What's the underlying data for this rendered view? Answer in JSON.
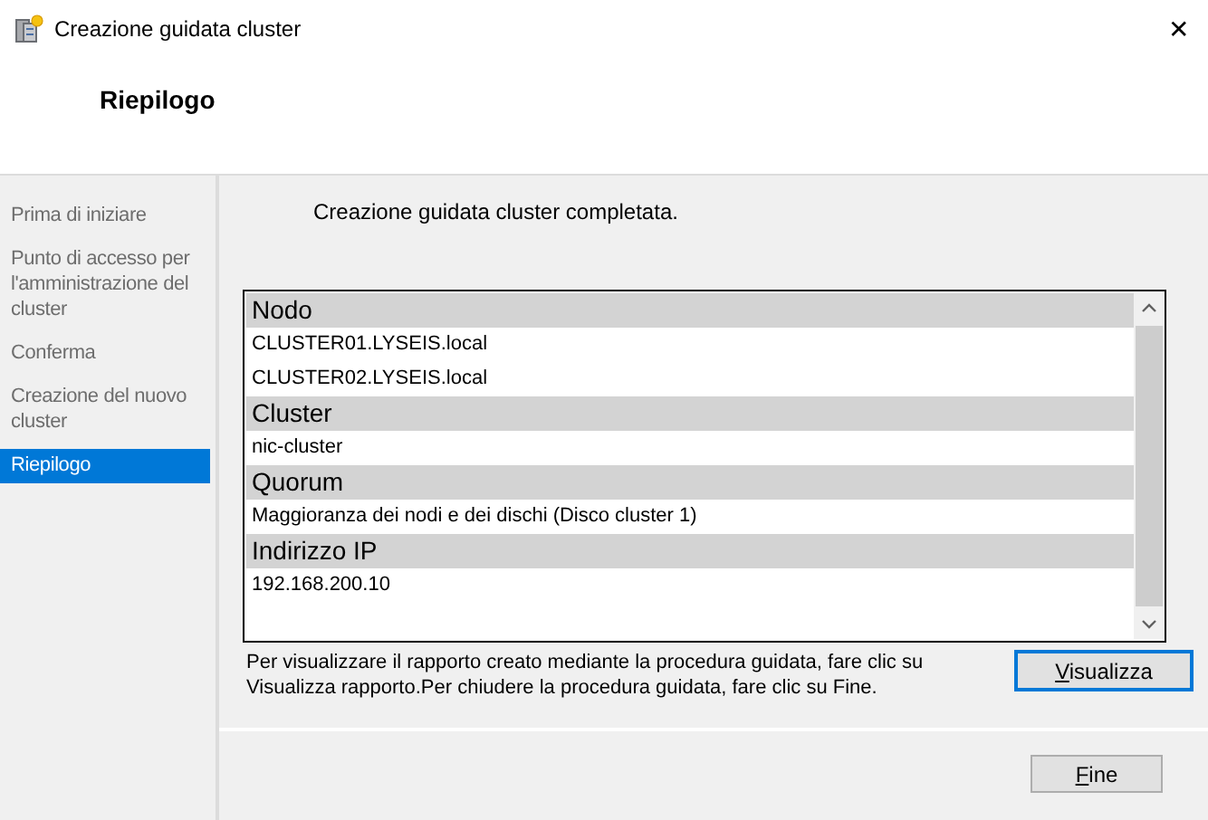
{
  "window": {
    "title": "Creazione guidata cluster",
    "close_glyph": "✕"
  },
  "header": {
    "title": "Riepilogo"
  },
  "steps": [
    {
      "label": "Prima di iniziare",
      "selected": false
    },
    {
      "label": "Punto di accesso per l'amministrazione del cluster",
      "selected": false
    },
    {
      "label": "Conferma",
      "selected": false
    },
    {
      "label": "Creazione del nuovo cluster",
      "selected": false
    },
    {
      "label": "Riepilogo",
      "selected": true
    }
  ],
  "message": "Creazione guidata cluster completata.",
  "report": {
    "sections": [
      {
        "heading": "Nodo",
        "values": [
          "CLUSTER01.LYSEIS.local",
          "CLUSTER02.LYSEIS.local"
        ]
      },
      {
        "heading": "Cluster",
        "values": [
          "nic-cluster"
        ]
      },
      {
        "heading": "Quorum",
        "values": [
          "Maggioranza dei nodi e dei dischi (Disco cluster 1)"
        ]
      },
      {
        "heading": "Indirizzo IP",
        "values": [
          "192.168.200.10"
        ]
      }
    ]
  },
  "hint": "Per visualizzare il rapporto creato mediante la procedura guidata, fare clic su Visualizza rapporto.Per chiudere la procedura guidata, fare clic su Fine.",
  "buttons": [
    {
      "label": "Visualizza",
      "default": true,
      "mnemonic": true
    },
    {
      "label": "Fine",
      "default": false,
      "mnemonic": true
    }
  ]
}
